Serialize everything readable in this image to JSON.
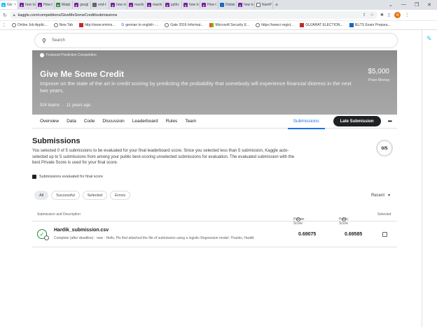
{
  "browser": {
    "tabs": [
      {
        "label": "Giv",
        "active": true
      },
      {
        "label": "how to"
      },
      {
        "label": "How t"
      },
      {
        "label": "Matpl"
      },
      {
        "label": "googl"
      },
      {
        "label": "end-t"
      },
      {
        "label": "how tc"
      },
      {
        "label": "machi"
      },
      {
        "label": "machi"
      },
      {
        "label": "pythc"
      },
      {
        "label": "how tc"
      },
      {
        "label": "How t"
      },
      {
        "label": "Distwi"
      },
      {
        "label": "how tc"
      },
      {
        "label": "NumP"
      }
    ],
    "new_tab": "+",
    "window_controls": [
      "⌄",
      "—",
      "❐",
      "✕"
    ],
    "url": "kaggle.com/competitions/GiveMeSomeCredit/submissions",
    "profile_initial": "N",
    "bookmarks": [
      "Online Job Applic...",
      "New Tab",
      "http://www.nmims...",
      "german to english -...",
      "Gate 2016 Informat...",
      "Microsoft Security E...",
      "https://www.i-regist...",
      "GUJARAT ELECTION...",
      "IELTS Exam Prepara..."
    ]
  },
  "search": {
    "placeholder": "Search"
  },
  "hero": {
    "featured": "Featured Prediction Competition",
    "title": "Give Me Some Credit",
    "description": "Improve on the state of the art in credit scoring by predicting the probability that somebody will experience financial distress in the next two years.",
    "prize": "$5,000",
    "prize_label": "Prize Money",
    "teams": "924 teams",
    "age": "11 years ago"
  },
  "subnav": {
    "items": [
      "Overview",
      "Data",
      "Code",
      "Discussion",
      "Leaderboard",
      "Rules",
      "Team"
    ],
    "active": "Submissions",
    "late_button": "Late Submission",
    "more": "•••"
  },
  "submissions": {
    "title": "Submissions",
    "intro": "You selected 0 of 5 submissions to be evaluated for your final leaderboard score. Since you selected less than 5 submission, Kaggle auto-selected up to 5 submissions from among your public best-scoring unselected submissions for evaluation. The evaluated submission with the best Private Score is used for your final score.",
    "counter": "0/5",
    "legend": "Submissions evaluated for final score",
    "filters": [
      "All",
      "Successful",
      "Selected",
      "Errors"
    ],
    "sort": "Recent",
    "columns": {
      "name": "Submission and Description",
      "private": "Private Score",
      "public": "Public Score",
      "selected": "Selected"
    },
    "rows": [
      {
        "file": "Hardik_submission.csv",
        "description": "Complete (after deadline) · now · Hello, Pls find attached the file of submission using a logistic Regression model. Thanks, Hardik",
        "private_score": "0.69075",
        "public_score": "0.69585",
        "selected": false
      }
    ]
  },
  "colors": {
    "accent": "#1a73e8",
    "success": "#1e8e3e",
    "dark_button": "#202124"
  }
}
